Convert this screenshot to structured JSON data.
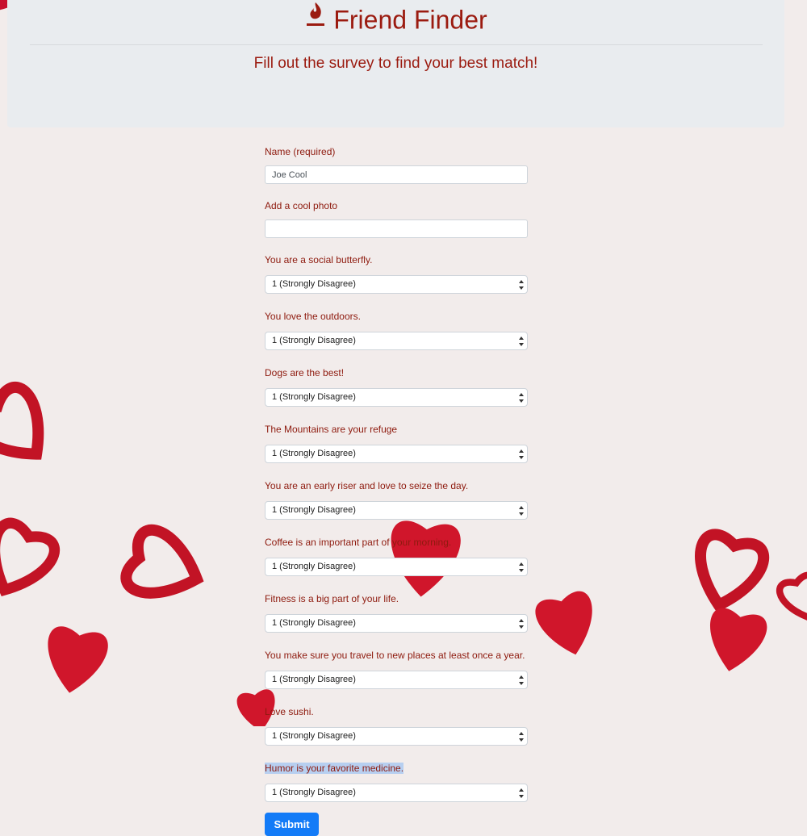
{
  "header": {
    "icon": "fire-icon",
    "title": "Friend Finder",
    "subtitle": "Fill out the survey to find your best match!"
  },
  "form": {
    "name": {
      "label": "Name (required)",
      "value": "Joe Cool"
    },
    "photo": {
      "label": "Add a cool photo",
      "value": ""
    },
    "questions": [
      {
        "label": "You are a social butterfly.",
        "selected": "1 (Strongly Disagree)"
      },
      {
        "label": "You love the outdoors.",
        "selected": "1 (Strongly Disagree)"
      },
      {
        "label": "Dogs are the best!",
        "selected": "1 (Strongly Disagree)"
      },
      {
        "label": "The Mountains are your refuge",
        "selected": "1 (Strongly Disagree)"
      },
      {
        "label": "You are an early riser and love to seize the day.",
        "selected": "1 (Strongly Disagree)"
      },
      {
        "label": "Coffee is an important part of your morning.",
        "selected": "1 (Strongly Disagree)"
      },
      {
        "label": "Fitness is a big part of your life.",
        "selected": "1 (Strongly Disagree)"
      },
      {
        "label": "You make sure you travel to new places at least once a year.",
        "selected": "1 (Strongly Disagree)"
      },
      {
        "label": "Love sushi.",
        "selected": "1 (Strongly Disagree)"
      },
      {
        "label": "Humor is your favorite medicine.",
        "selected": "1 (Strongly Disagree)"
      }
    ],
    "submit_label": "Submit"
  },
  "colors": {
    "brand": "#9b1b10",
    "button": "#137bf7",
    "jumbotron": "#e9ecef",
    "heart": "#c8102e"
  }
}
